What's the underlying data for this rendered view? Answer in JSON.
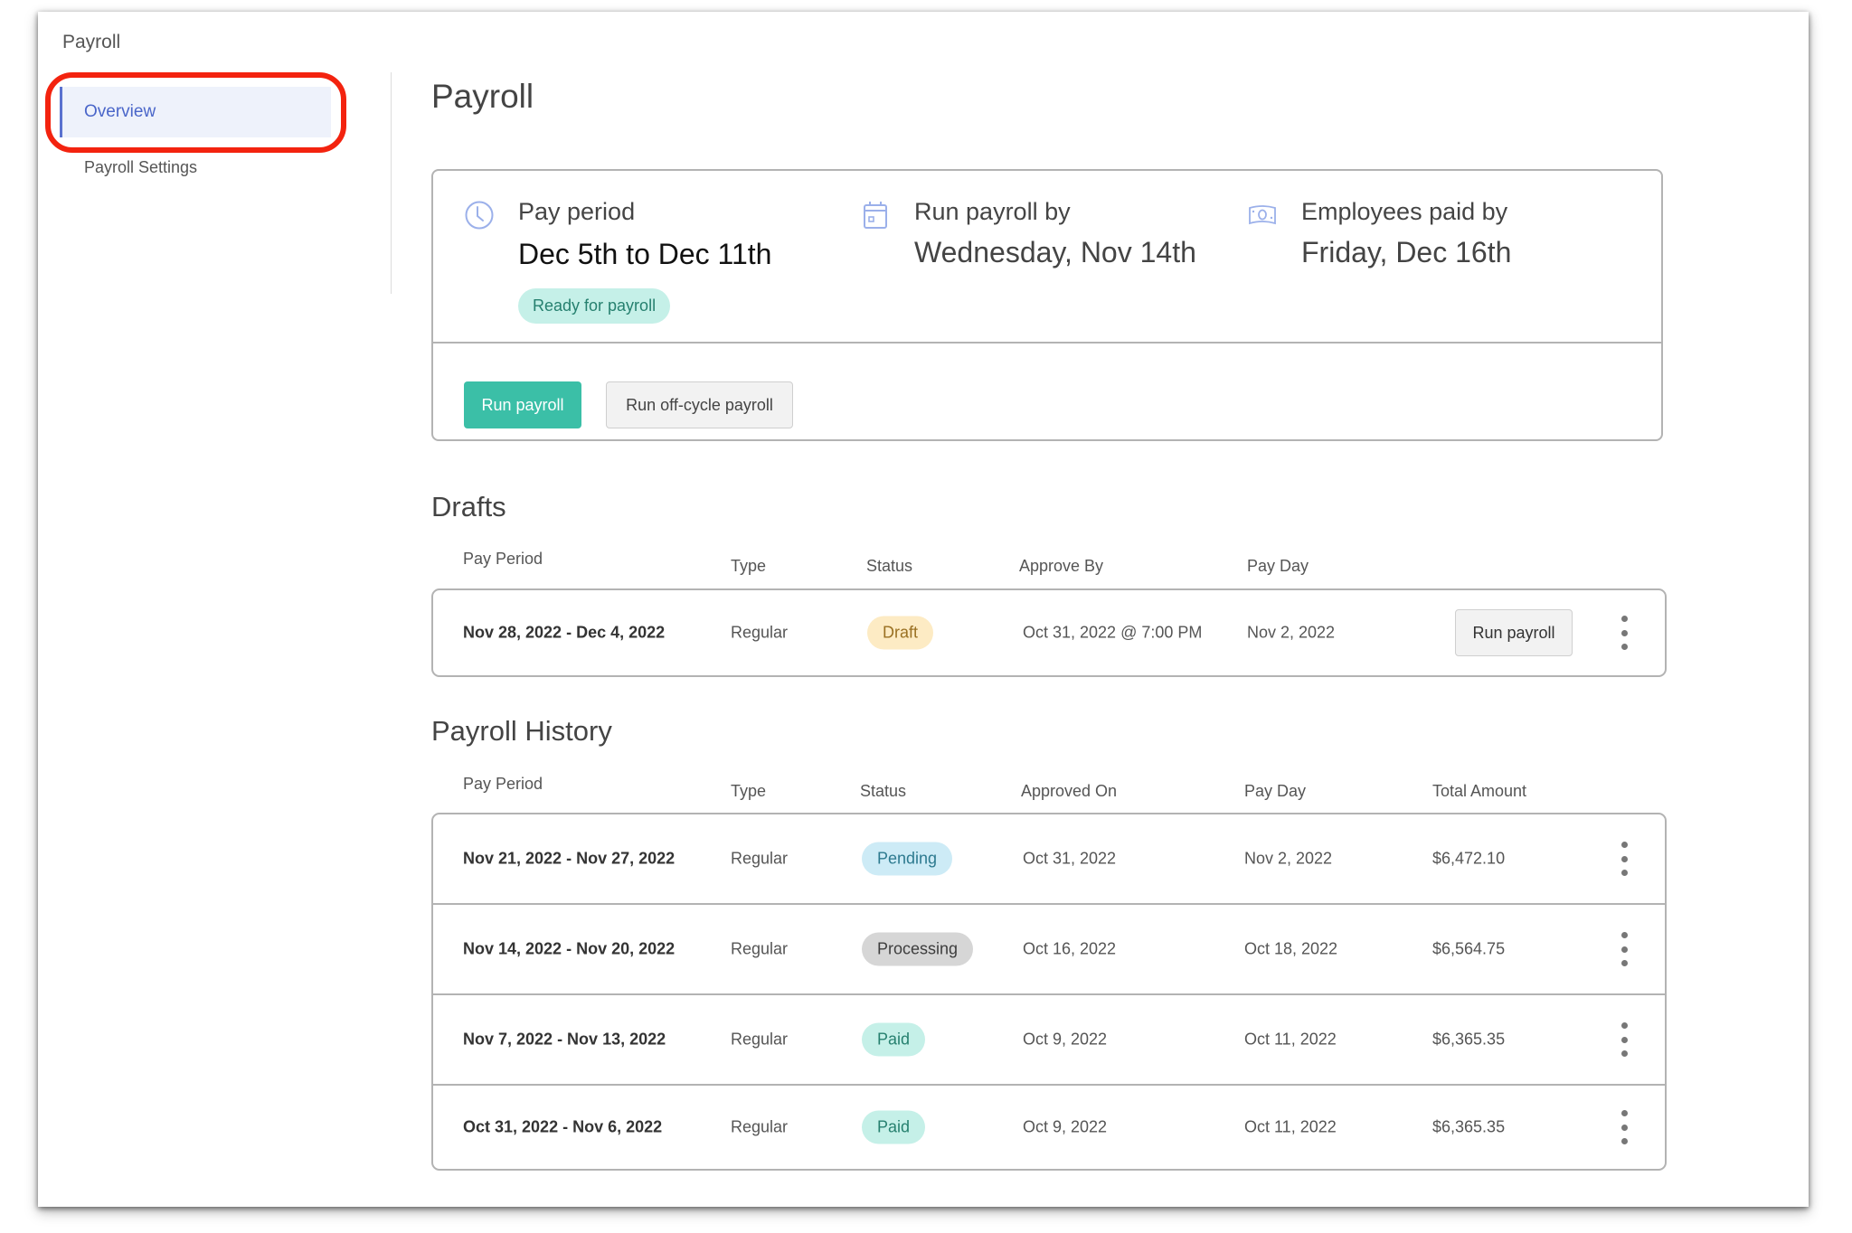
{
  "sidebar": {
    "title": "Payroll",
    "items": [
      {
        "label": "Overview",
        "active": true
      },
      {
        "label": "Payroll Settings",
        "active": false
      }
    ]
  },
  "page": {
    "title": "Payroll"
  },
  "summary": {
    "pay_period": {
      "icon": "clock-icon",
      "label": "Pay period",
      "value": "Dec 5th to Dec 11th",
      "badge": "Ready for payroll"
    },
    "run_by": {
      "icon": "calendar-icon",
      "label": "Run payroll by",
      "value": "Wednesday, Nov 14th"
    },
    "paid_by": {
      "icon": "banknote-icon",
      "label": "Employees paid by",
      "value": "Friday, Dec 16th"
    },
    "actions": {
      "run_payroll": "Run payroll",
      "run_off_cycle": "Run off-cycle payroll"
    }
  },
  "drafts": {
    "title": "Drafts",
    "headers": [
      "Pay Period",
      "Type",
      "Status",
      "Approve By",
      "Pay Day"
    ],
    "rows": [
      {
        "period": "Nov 28, 2022 - Dec 4, 2022",
        "type": "Regular",
        "status": "Draft",
        "approve_by": "Oct 31, 2022 @ 7:00 PM",
        "pay_day": "Nov 2, 2022",
        "action": "Run payroll"
      }
    ]
  },
  "history": {
    "title": "Payroll History",
    "headers": [
      "Pay Period",
      "Type",
      "Status",
      "Approved On",
      "Pay Day",
      "Total Amount"
    ],
    "rows": [
      {
        "period": "Nov 21, 2022 - Nov 27, 2022",
        "type": "Regular",
        "status": "Pending",
        "approved_on": "Oct 31, 2022",
        "pay_day": "Nov 2, 2022",
        "total": "$6,472.10"
      },
      {
        "period": "Nov 14, 2022 - Nov 20, 2022",
        "type": "Regular",
        "status": "Processing",
        "approved_on": "Oct 16, 2022",
        "pay_day": "Oct 18, 2022",
        "total": "$6,564.75"
      },
      {
        "period": "Nov 7, 2022 - Nov 13, 2022",
        "type": "Regular",
        "status": "Paid",
        "approved_on": "Oct 9, 2022",
        "pay_day": "Oct 11, 2022",
        "total": "$6,365.35"
      },
      {
        "period": "Oct 31, 2022 - Nov 6, 2022",
        "type": "Regular",
        "status": "Paid",
        "approved_on": "Oct 9, 2022",
        "pay_day": "Oct 11, 2022",
        "total": "$6,365.35"
      }
    ]
  },
  "colors": {
    "accent": "#3bbfa7",
    "nav_active": "#4a66c9",
    "highlight_ring": "#f3230f",
    "icon": "#9bb0ea",
    "status_draft": "#fdebc4",
    "status_pending": "#cdebf6",
    "status_processing": "#d6d6d6",
    "status_paid": "#c5f0e8"
  }
}
